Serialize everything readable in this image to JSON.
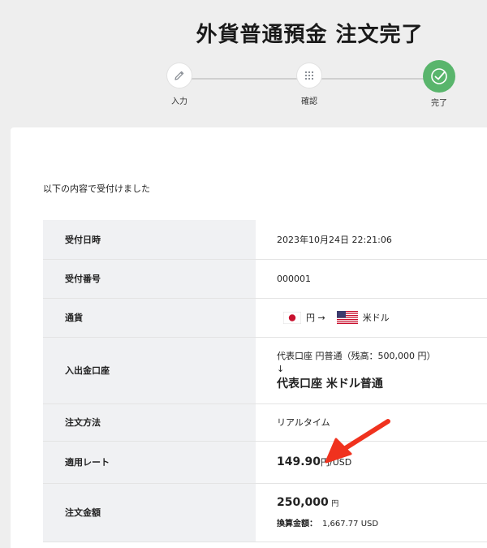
{
  "page": {
    "title": "外貨普通預金 注文完了"
  },
  "steps": [
    {
      "label": "入力",
      "icon": "pencil-icon",
      "state": "done"
    },
    {
      "label": "確認",
      "icon": "grid-icon",
      "state": "done"
    },
    {
      "label": "完了",
      "icon": "check-circle-icon",
      "state": "current"
    }
  ],
  "colors": {
    "accent": "#59b56c",
    "table_key_bg": "#f0f1f3",
    "annotation": "#f0321e"
  },
  "intro": "以下の内容で受付けました",
  "rows": {
    "date": {
      "key": "受付日時",
      "value": "2023年10月24日 22:21:06"
    },
    "number": {
      "key": "受付番号",
      "value": "000001"
    },
    "currency": {
      "key": "通貨",
      "from": "円 →",
      "to": "米ドル",
      "from_icon": "japan-flag-icon",
      "to_icon": "us-flag-icon"
    },
    "account": {
      "key": "入出金口座",
      "from": "代表口座 円普通（残高：500,000 円）",
      "arrow": "↓",
      "to": "代表口座 米ドル普通"
    },
    "method": {
      "key": "注文方法",
      "value": "リアルタイム"
    },
    "rate": {
      "key": "適用レート",
      "value": "149.90",
      "unit": "円/USD"
    },
    "amount": {
      "key": "注文金額",
      "value": "250,000",
      "unit": "円",
      "converted_label": "換算金額：",
      "converted_value": "1,667.77 USD"
    }
  }
}
